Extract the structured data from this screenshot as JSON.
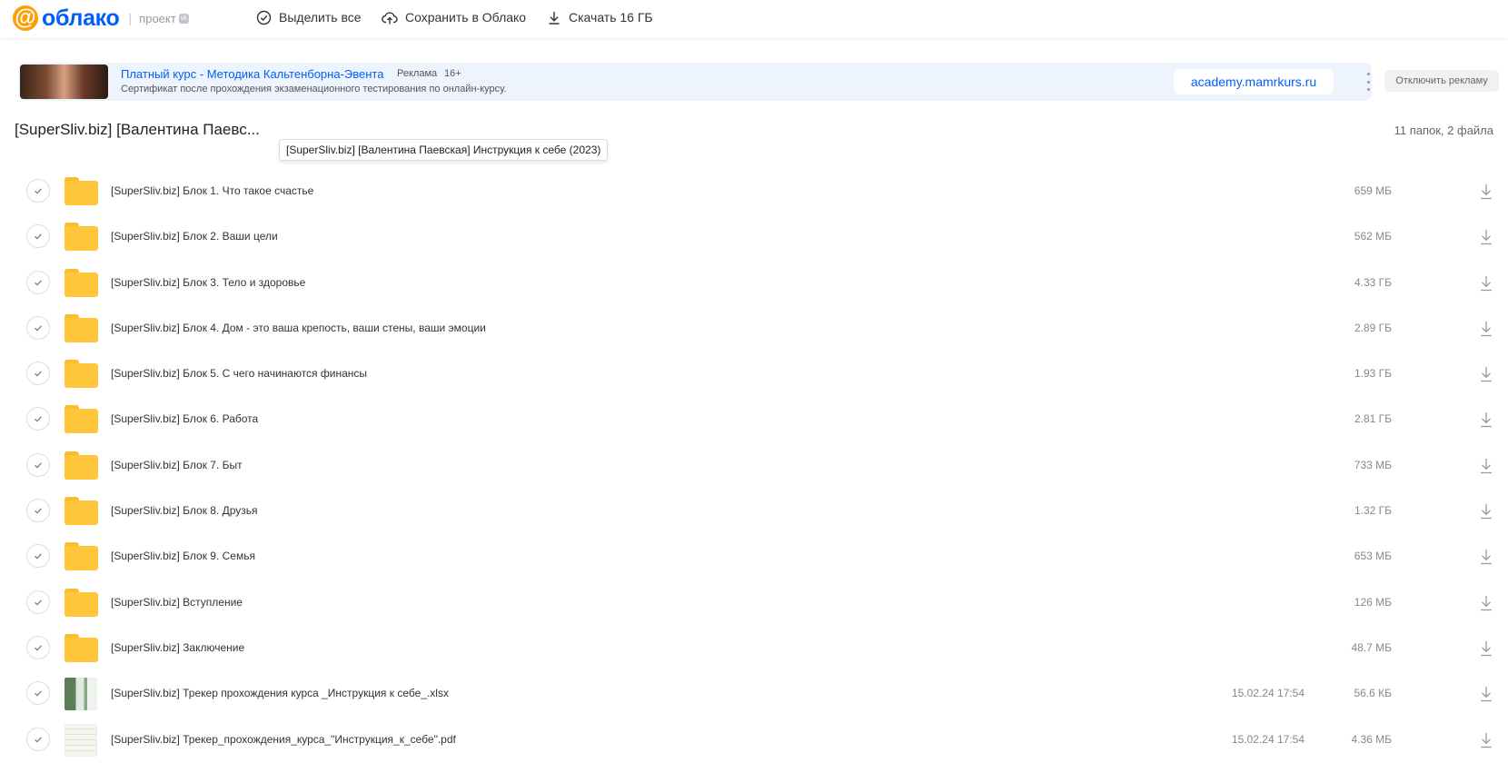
{
  "logo": {
    "brand": "облако",
    "project": "проект",
    "vk": "vk"
  },
  "toolbar": {
    "select_all": "Выделить все",
    "save_to_cloud": "Сохранить в Облако",
    "download": "Скачать 16 ГБ"
  },
  "ad": {
    "title": "Платный курс - Методика Кальтенборна-Эвента",
    "label": "Реклама",
    "age": "16+",
    "description": "Сертификат после прохождения экзаменационного тестирования по онлайн-курсу.",
    "link": "academy.mamrkurs.ru",
    "disable": "Отключить рекламу"
  },
  "folder": {
    "title": "[SuperSliv.biz] [Валентина Паевс...",
    "tooltip": "[SuperSliv.biz] [Валентина Паевская] Инструкция к себе (2023)",
    "count": "11 папок, 2 файла"
  },
  "items": [
    {
      "type": "folder",
      "name": "[SuperSliv.biz] Блок 1. Что такое счастье",
      "date": "",
      "size": "659 МБ"
    },
    {
      "type": "folder",
      "name": "[SuperSliv.biz] Блок 2. Ваши цели",
      "date": "",
      "size": "562 МБ"
    },
    {
      "type": "folder",
      "name": "[SuperSliv.biz] Блок 3. Тело и здоровье",
      "date": "",
      "size": "4.33 ГБ"
    },
    {
      "type": "folder",
      "name": "[SuperSliv.biz] Блок 4. Дом - это ваша крепость, ваши стены, ваши эмоции",
      "date": "",
      "size": "2.89 ГБ"
    },
    {
      "type": "folder",
      "name": "[SuperSliv.biz] Блок 5. С чего начинаются финансы",
      "date": "",
      "size": "1.93 ГБ"
    },
    {
      "type": "folder",
      "name": "[SuperSliv.biz] Блок 6. Работа",
      "date": "",
      "size": "2.81 ГБ"
    },
    {
      "type": "folder",
      "name": "[SuperSliv.biz] Блок 7. Быт",
      "date": "",
      "size": "733 МБ"
    },
    {
      "type": "folder",
      "name": "[SuperSliv.biz] Блок 8. Друзья",
      "date": "",
      "size": "1.32 ГБ"
    },
    {
      "type": "folder",
      "name": "[SuperSliv.biz] Блок 9. Семья",
      "date": "",
      "size": "653 МБ"
    },
    {
      "type": "folder",
      "name": "[SuperSliv.biz] Вступление",
      "date": "",
      "size": "126 МБ"
    },
    {
      "type": "folder",
      "name": "[SuperSliv.biz] Заключение",
      "date": "",
      "size": "48.7 МБ"
    },
    {
      "type": "xlsx",
      "name": "[SuperSliv.biz] Трекер прохождения курса _Инструкция к себе_.xlsx",
      "date": "15.02.24 17:54",
      "size": "56.6 КБ"
    },
    {
      "type": "pdf",
      "name": "[SuperSliv.biz] Трекер_прохождения_курса_\"Инструкция_к_себе\".pdf",
      "date": "15.02.24 17:54",
      "size": "4.36 МБ"
    }
  ],
  "colors": {
    "accent": "#005ff9",
    "logo_orange": "#ff9e00",
    "folder": "#ffc63b",
    "ad_bg": "#eef4fd"
  },
  "icons": {
    "select_all": "check-circle-icon",
    "save": "cloud-upload-icon",
    "download": "download-icon",
    "more": "more-vertical-icon"
  }
}
